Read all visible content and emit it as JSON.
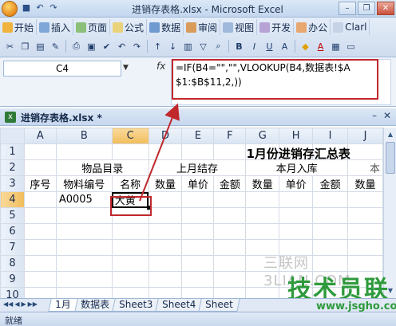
{
  "window": {
    "title": "进销存表格.xlsx - Microsoft Excel",
    "minimize": "–",
    "restore": "❐",
    "close": "✕"
  },
  "ribbon": {
    "tabs": [
      "开始",
      "插入",
      "页面",
      "公式",
      "数据",
      "审阅",
      "视图",
      "开发",
      "办公",
      "Clarl"
    ]
  },
  "formula_bar": {
    "name_box": "C4",
    "fx_label": "fx",
    "formula": "=IF(B4=\"\",\"\",VLOOKUP(B4,数据表!$A$1:$B$11,2,))"
  },
  "workbook": {
    "name": "进销存表格.xlsx *",
    "ctrl_min": "–",
    "ctrl_close": "✕"
  },
  "sheet": {
    "columns": [
      "A",
      "B",
      "C",
      "D",
      "E",
      "F",
      "G",
      "H",
      "I",
      "J"
    ],
    "rows": [
      "1",
      "2",
      "3",
      "4",
      "5",
      "6",
      "7",
      "8",
      "9",
      "10"
    ],
    "title": "1月份进销存汇总表",
    "group_headers": {
      "item_catalog": "物品目录",
      "last_month_stock": "上月结存",
      "this_month_in": "本月入库",
      "partial": "本"
    },
    "field_headers": {
      "seq": "序号",
      "item_code": "物料编号",
      "name": "名称",
      "qty1": "数量",
      "price1": "单价",
      "amount1": "金额",
      "qty2": "数量",
      "price2": "单价",
      "amount2": "金额",
      "qty3": "数量"
    },
    "row4": {
      "item_code": "A0005",
      "name": "大黄"
    }
  },
  "sheet_tabs": {
    "nav_first": "◀◀",
    "nav_prev": "◀",
    "nav_next": "▶",
    "nav_last": "▶▶",
    "tabs": [
      "1月",
      "数据表",
      "Sheet3",
      "Sheet4",
      "Sheet"
    ]
  },
  "status_bar": {
    "text": "就绪"
  },
  "watermark": {
    "site_text": "三联网 3LIAN.COM",
    "logo": "技术员联盟",
    "url": "www.jsgho.com"
  },
  "colors": {
    "annotation_red": "#c0282c",
    "watermark_green": "#2e9a3c"
  }
}
